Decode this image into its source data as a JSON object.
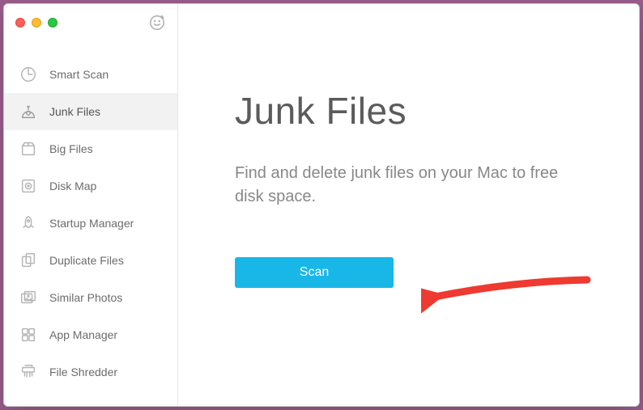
{
  "sidebar": {
    "items": [
      {
        "label": "Smart Scan"
      },
      {
        "label": "Junk Files"
      },
      {
        "label": "Big Files"
      },
      {
        "label": "Disk Map"
      },
      {
        "label": "Startup Manager"
      },
      {
        "label": "Duplicate Files"
      },
      {
        "label": "Similar Photos"
      },
      {
        "label": "App Manager"
      },
      {
        "label": "File Shredder"
      }
    ]
  },
  "main": {
    "title": "Junk Files",
    "description": "Find and delete junk files on your Mac to free disk space.",
    "scan_label": "Scan"
  },
  "colors": {
    "accent": "#19b7e7",
    "arrow": "#ee3a30"
  }
}
